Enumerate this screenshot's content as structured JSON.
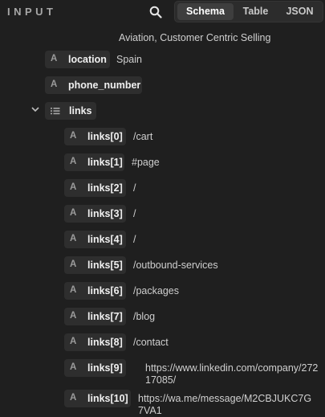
{
  "header": {
    "title": "INPUT",
    "tabs": [
      {
        "label": "Schema",
        "active": true
      },
      {
        "label": "Table",
        "active": false
      },
      {
        "label": "JSON",
        "active": false
      }
    ]
  },
  "fields": {
    "truncated_text": "Aviation, Customer Centric Selling",
    "location": {
      "type": "A",
      "key": "location",
      "value": "Spain"
    },
    "phone_number": {
      "type": "A",
      "key": "phone_number"
    },
    "links": {
      "key": "links",
      "items": [
        {
          "type": "A",
          "key": "links[0]",
          "value": "/cart"
        },
        {
          "type": "A",
          "key": "links[1]",
          "value": "#page"
        },
        {
          "type": "A",
          "key": "links[2]",
          "value": "/"
        },
        {
          "type": "A",
          "key": "links[3]",
          "value": "/"
        },
        {
          "type": "A",
          "key": "links[4]",
          "value": "/"
        },
        {
          "type": "A",
          "key": "links[5]",
          "value": "/outbound-services"
        },
        {
          "type": "A",
          "key": "links[6]",
          "value": "/packages"
        },
        {
          "type": "A",
          "key": "links[7]",
          "value": "/blog"
        },
        {
          "type": "A",
          "key": "links[8]",
          "value": "/contact"
        },
        {
          "type": "A",
          "key": "links[9]",
          "value": "https://www.linkedin.com/company/27217085/"
        },
        {
          "type": "A",
          "key": "links[10]",
          "value": "https://wa.me/message/M2CBJUKC7G7VA1"
        }
      ]
    }
  },
  "icons": {
    "search": "search-icon",
    "expand": "chevron-down-icon",
    "array": "list-icon"
  },
  "colors": {
    "background": "#1f1f1f",
    "chip": "#2e2e2e",
    "active_tab": "#3e3e3e"
  }
}
